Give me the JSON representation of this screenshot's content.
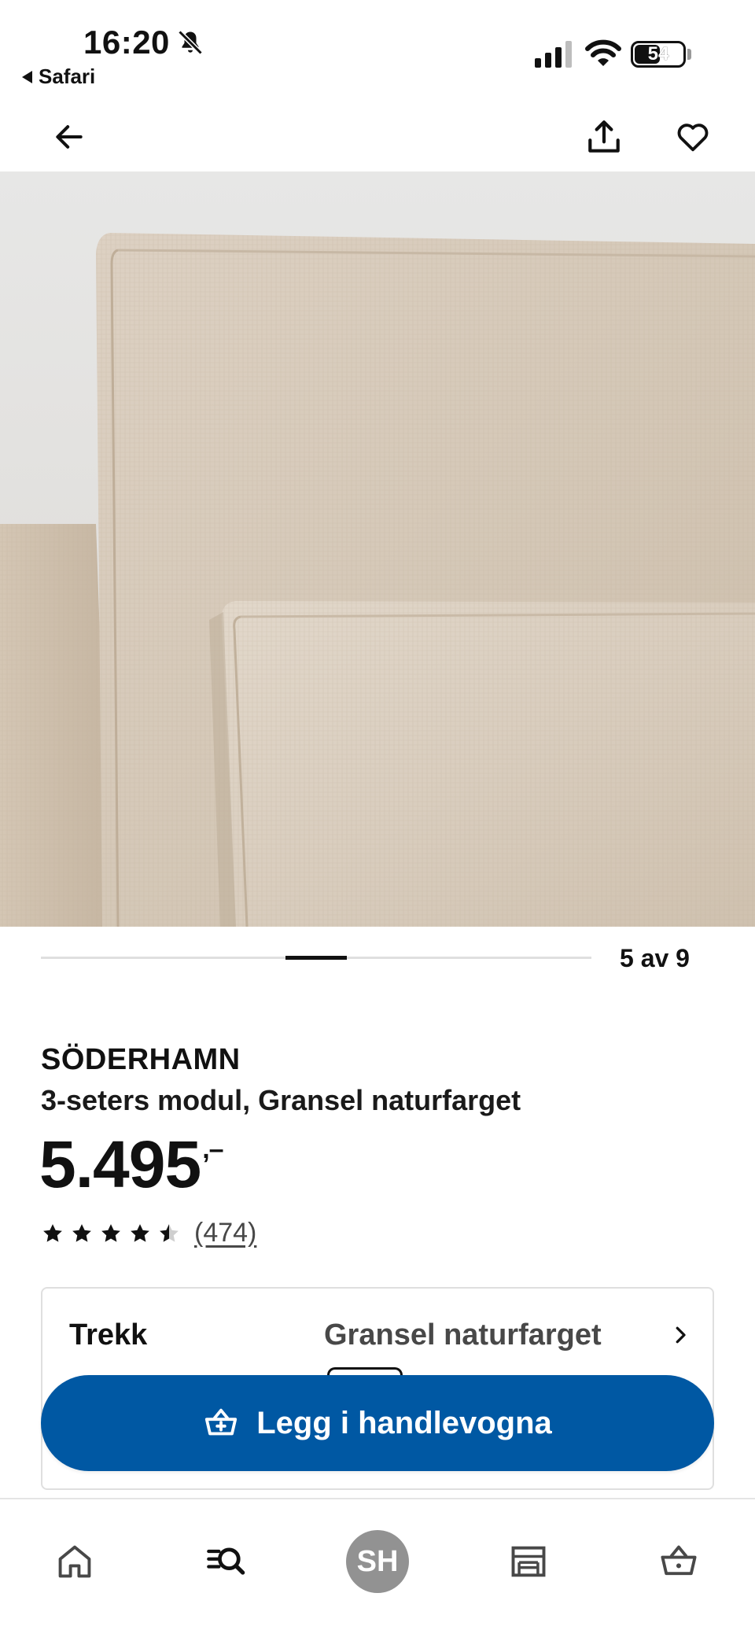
{
  "status_bar": {
    "time": "16:20",
    "back_app": "Safari",
    "battery": "54",
    "battery_level": 0.54
  },
  "nav": {
    "back_icon": "arrow-left-icon",
    "share_icon": "share-icon",
    "favorite_icon": "heart-icon"
  },
  "carousel": {
    "counter": "5 av 9",
    "current": 5,
    "total": 9
  },
  "product": {
    "name": "SÖDERHAMN",
    "description": "3-seters modul, Gransel naturfarget",
    "price": "5.495",
    "price_suffix": ",–",
    "rating": 4.5,
    "rating_max": 5,
    "review_count": "(474)"
  },
  "variant": {
    "label": "Trekk",
    "value": "Gransel naturfarget"
  },
  "cart_button": {
    "label": "Legg i handlevogna"
  },
  "tabbar": {
    "avatar_initials": "SH",
    "items": [
      "home-icon",
      "search-icon",
      "profile-avatar",
      "store-icon",
      "basket-icon"
    ]
  },
  "colors": {
    "accent": "#0058a3",
    "text": "#111111",
    "muted": "#484848",
    "fabric": "#d8cbbb"
  }
}
